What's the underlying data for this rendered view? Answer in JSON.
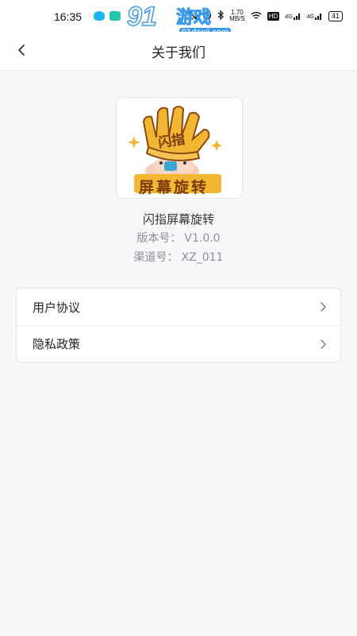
{
  "status_bar": {
    "time": "16:35",
    "net_speed_value": "1.70",
    "net_speed_unit": "MB/S",
    "hd": "HD",
    "signal1": "4G",
    "signal2": "4G",
    "battery": "41"
  },
  "watermark": {
    "number": "91",
    "text": "游戏",
    "url": "91danji.com"
  },
  "nav": {
    "title": "关于我们"
  },
  "app": {
    "logo_text": "屏幕旋转",
    "logo_hat_text": "闪指",
    "name": "闪指屏幕旋转",
    "version_label": "版本号：",
    "version_value": "V1.0.0",
    "channel_label": "渠道号：",
    "channel_value": "XZ_011"
  },
  "menu": {
    "items": [
      {
        "label": "用户协议"
      },
      {
        "label": "隐私政策"
      }
    ]
  },
  "colors": {
    "background": "#f7f7f9",
    "card": "#ffffff",
    "secondary_text": "#8d9099",
    "watermark_blue": "#3f9be9",
    "logo_gold": "#f2b632",
    "logo_text_brown": "#7a3b0a"
  }
}
